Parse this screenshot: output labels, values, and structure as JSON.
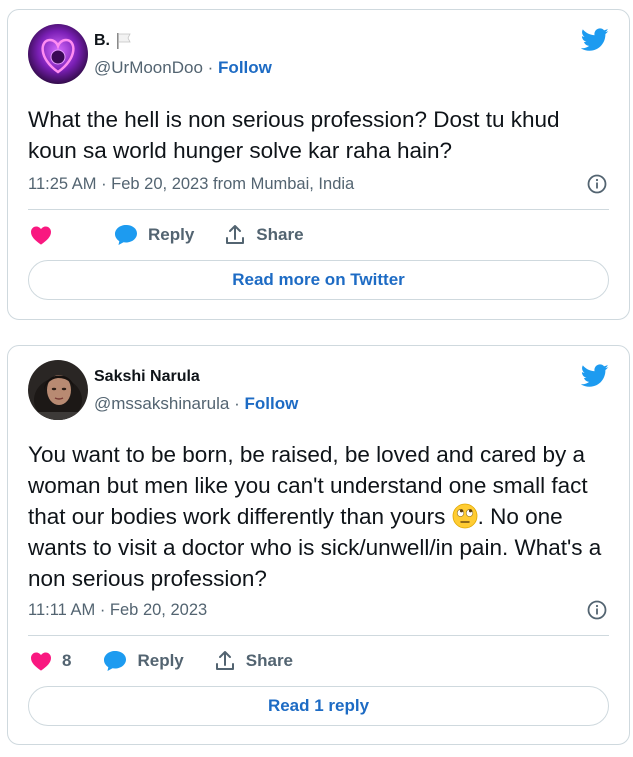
{
  "tweets": [
    {
      "name": "B.",
      "handle": "@UrMoonDoo",
      "separator": "·",
      "follow_label": "Follow",
      "text": "What the hell is non serious profession? Dost tu khud koun sa world hunger solve kar raha hain?",
      "time": "11:25 AM · Feb 20, 2023",
      "location": " from Mumbai, India",
      "like_count": "",
      "reply_label": "Reply",
      "share_label": "Share",
      "read_label": "Read more on Twitter"
    },
    {
      "name": "Sakshi Narula",
      "handle": "@mssakshinarula",
      "separator": "·",
      "follow_label": "Follow",
      "text_before_emoji": "You want to be born, be raised, be loved and cared by a woman but men like you can't understand one small fact that our bodies work differently than yours ",
      "text_after_emoji": ". No one wants to visit a doctor who is sick/unwell/in pain. What's a non serious profession?",
      "time": "11:11 AM · Feb 20, 2023",
      "like_count": "8",
      "reply_label": "Reply",
      "share_label": "Share",
      "read_label": "Read 1 reply"
    }
  ],
  "icons": {
    "brand": "twitter-bird-icon",
    "like": "heart-icon",
    "reply": "speech-bubble-icon",
    "share": "share-upload-icon",
    "info": "info-icon",
    "flag": "white-flag-icon",
    "emoji": "eye-roll-emoji"
  },
  "colors": {
    "twitter_blue": "#1d9bf0",
    "link_blue": "#1d6bc4",
    "heart": "#f91880",
    "muted": "#536471",
    "border": "#cfd9de"
  }
}
